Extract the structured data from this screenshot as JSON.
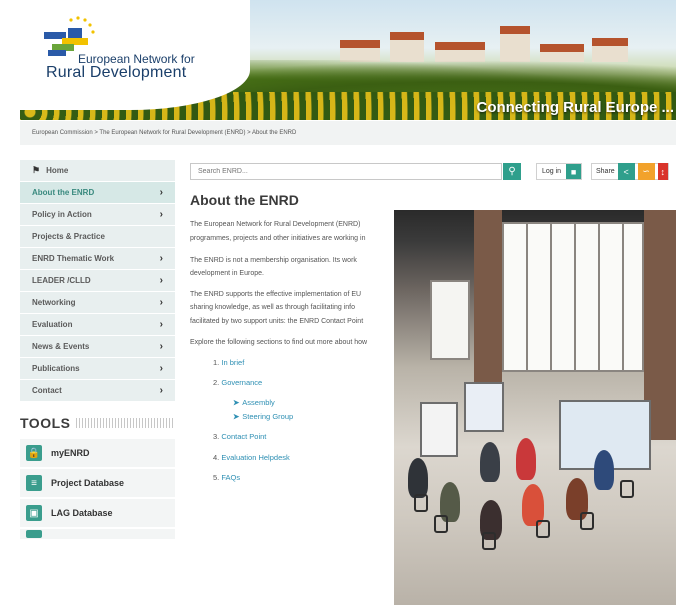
{
  "header": {
    "logo_line1": "European Network for",
    "logo_line2": "Rural Development",
    "tagline": "Connecting Rural Europe ..."
  },
  "breadcrumb": "European Commission > The European Network for Rural Development (ENRD) > About the ENRD",
  "nav": {
    "home": "Home",
    "items": [
      {
        "label": "About the ENRD",
        "chevron": "›"
      },
      {
        "label": "Policy in Action",
        "chevron": "›"
      },
      {
        "label": "Projects & Practice",
        "chevron": ""
      },
      {
        "label": "ENRD Thematic Work",
        "chevron": "›"
      },
      {
        "label": "LEADER /CLLD",
        "chevron": "›"
      },
      {
        "label": "Networking",
        "chevron": "›"
      },
      {
        "label": "Evaluation",
        "chevron": "›"
      },
      {
        "label": "News & Events",
        "chevron": "›"
      },
      {
        "label": "Publications",
        "chevron": "›"
      },
      {
        "label": "Contact",
        "chevron": "›"
      }
    ]
  },
  "tools": {
    "title": "TOOLS",
    "items": [
      {
        "label": "myENRD"
      },
      {
        "label": "Project Database"
      },
      {
        "label": "LAG Database"
      }
    ]
  },
  "search": {
    "placeholder": "Search ENRD..."
  },
  "toolbar": {
    "login": "Log in",
    "share": "Share"
  },
  "main": {
    "title": "About the ENRD",
    "lines": [
      "The European Network for Rural Development (ENRD)",
      "programmes, projects and other initiatives are working in",
      "The ENRD is not a membership organisation. Its work",
      "development in Europe.",
      "The ENRD supports the effective implementation of EU",
      "sharing knowledge, as well as through facilitating info",
      "facilitated by two support units: the ENRD Contact Point",
      "Explore the following sections to find out more about how"
    ],
    "list": [
      {
        "num": "1.",
        "label": "In brief"
      },
      {
        "num": "2.",
        "label": "Governance"
      },
      {
        "num": "3.",
        "label": "Contact Point"
      },
      {
        "num": "4.",
        "label": "Evaluation Helpdesk"
      },
      {
        "num": "5.",
        "label": "FAQs"
      }
    ],
    "sublist": [
      "Assembly",
      "Steering Group"
    ]
  },
  "colors": {
    "accent": "#2f9f8c",
    "link": "#2e8fb3",
    "nav_bg": "#e8efef",
    "nav_active": "#d6e8e6"
  }
}
